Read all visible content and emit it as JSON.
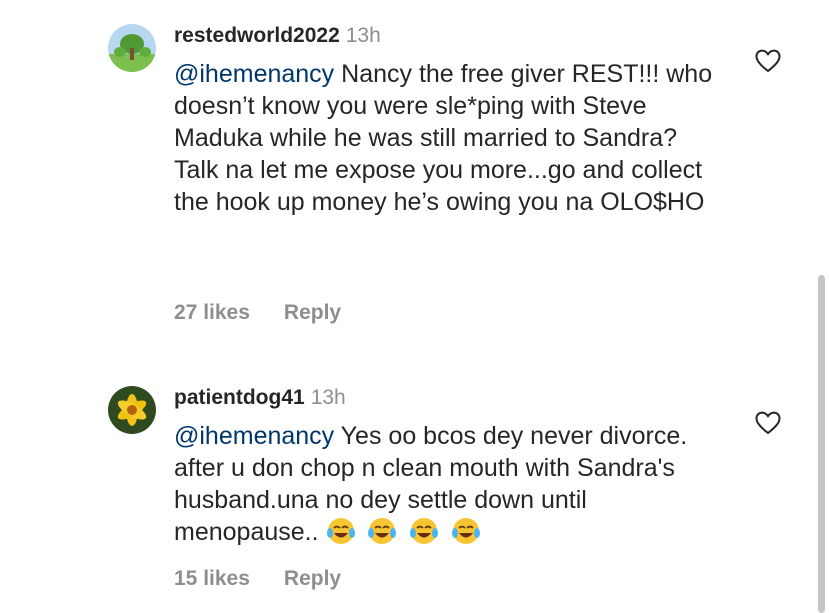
{
  "comments": [
    {
      "username": "restedworld2022",
      "time": "13h",
      "mention": "@ihemenancy",
      "text": " Nancy the free giver REST!!! who doesn’t know you were sle*ping with Steve Maduka while he was still married to Sandra? Talk na let me expose you more...go and collect the hook up money he’s owing you na OLO$HO",
      "likes": "27 likes",
      "reply": "Reply"
    },
    {
      "username": "patientdog41",
      "time": "13h",
      "mention": "@ihemenancy",
      "text": " Yes oo bcos dey never divorce. after u don chop n clean mouth with Sandra's husband.una no dey settle down until menopause..",
      "likes": "15 likes",
      "reply": "Reply"
    }
  ],
  "icons": {
    "like": "heart-icon",
    "emoji": "face-with-tears-of-joy"
  }
}
